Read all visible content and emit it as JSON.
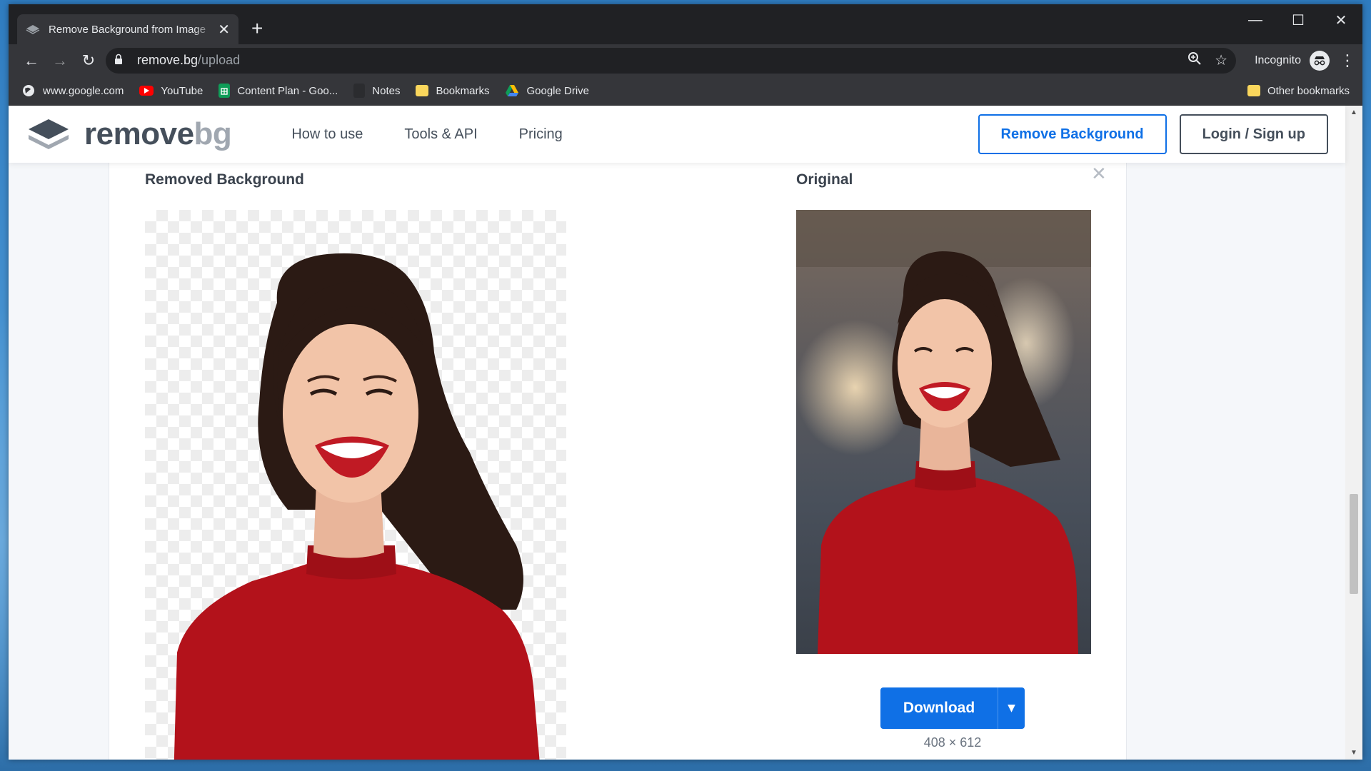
{
  "browser": {
    "tab_title": "Remove Background from Image",
    "new_tab_symbol": "+",
    "url_host": "remove.bg",
    "url_path": "/upload",
    "incognito_label": "Incognito",
    "bookmarks": [
      {
        "label": "www.google.com",
        "icon": "globe-icon"
      },
      {
        "label": "YouTube",
        "icon": "youtube-icon"
      },
      {
        "label": "Content Plan - Goo...",
        "icon": "sheets-icon"
      },
      {
        "label": "Notes",
        "icon": "notes-icon"
      },
      {
        "label": "Bookmarks",
        "icon": "folder-icon"
      },
      {
        "label": "Google Drive",
        "icon": "drive-icon"
      }
    ],
    "other_bookmarks": "Other bookmarks"
  },
  "site": {
    "logo_remove": "remove",
    "logo_bg": "bg",
    "nav": [
      "How to use",
      "Tools & API",
      "Pricing"
    ],
    "cta_remove": "Remove Background",
    "cta_login": "Login / Sign up"
  },
  "result": {
    "removed_title": "Removed Background",
    "original_title": "Original",
    "download_label": "Download",
    "dimensions": "408 × 612"
  },
  "colors": {
    "accent": "#0f70e6",
    "shirt": "#b5141c",
    "chrome_dark": "#202124"
  }
}
